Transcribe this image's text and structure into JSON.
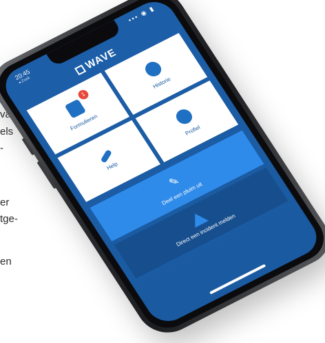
{
  "background_text": [
    "var-",
    "els",
    "-",
    "er",
    "tge-",
    "en"
  ],
  "status_bar": {
    "time": "20:45",
    "sub": "◂ Zoek",
    "icons": "▪▪▪ ◉ ▮"
  },
  "app": {
    "logo": "WAVE"
  },
  "tiles": [
    {
      "label": "Formulieren",
      "icon": "document-icon",
      "badge": "1"
    },
    {
      "label": "Historie",
      "icon": "history-icon"
    },
    {
      "label": "Help",
      "icon": "wrench-icon"
    },
    {
      "label": "Profiel",
      "icon": "user-icon"
    }
  ],
  "actions": {
    "share_label": "Deel een pluim uit",
    "report_label": "Direct een incident melden"
  },
  "colors": {
    "primary": "#1c5ea8",
    "accent": "#2f8bea",
    "dark": "#174f8e",
    "badge": "#e8483b"
  }
}
